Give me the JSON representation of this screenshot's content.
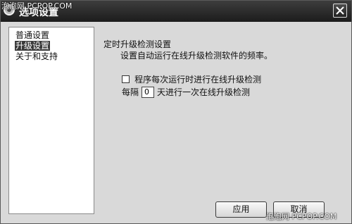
{
  "window": {
    "title": "选项设置",
    "close_icon": "close-icon"
  },
  "watermark": {
    "top": "泡泡网 PCPOP.COM",
    "bottom": "泡泡网 PCPOP.COM"
  },
  "sidebar": {
    "items": [
      {
        "label": "普通设置",
        "selected": false
      },
      {
        "label": "升级设置",
        "selected": true
      },
      {
        "label": "关于和支持",
        "selected": false
      }
    ]
  },
  "main": {
    "section_title": "定时升级检测设置",
    "section_desc": "设置自动运行在线升级检测软件的频率。",
    "checkbox_label": "程序每次运行时进行在线升级检测",
    "checkbox_checked": false,
    "interval_prefix": "每隔",
    "interval_value": "0",
    "interval_suffix": "天进行一次在线升级检测"
  },
  "buttons": {
    "apply": "应用",
    "cancel": "取消"
  }
}
